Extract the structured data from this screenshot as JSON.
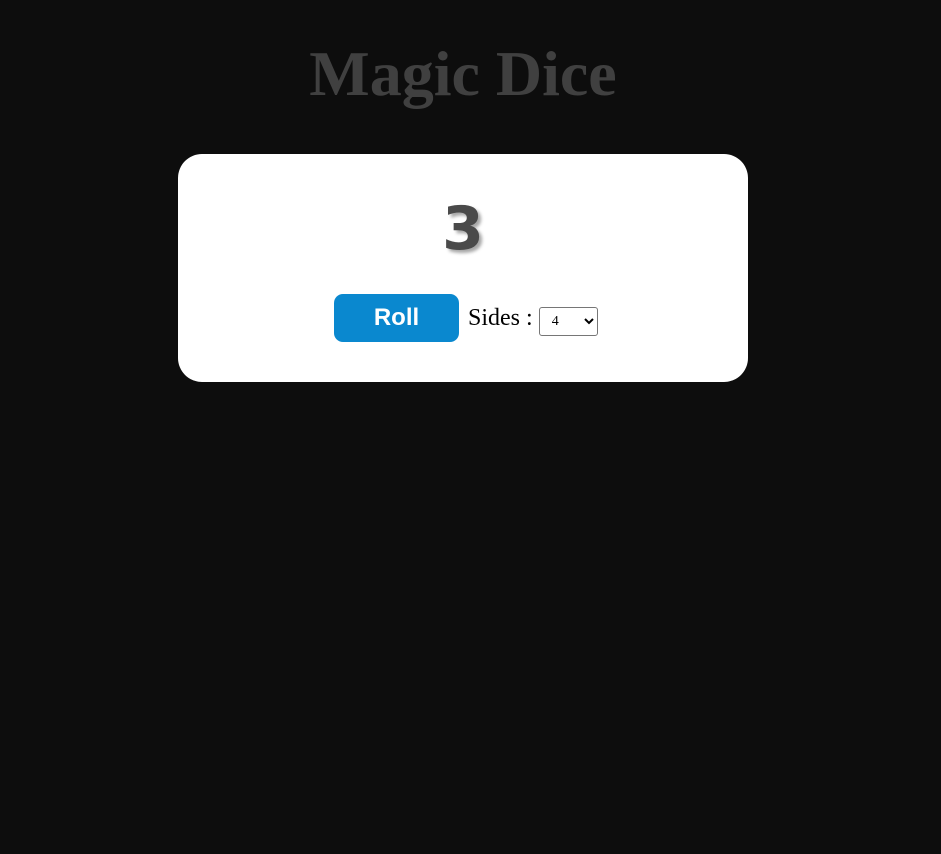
{
  "app": {
    "title": "Magic Dice"
  },
  "dice": {
    "result": "3"
  },
  "controls": {
    "roll_label": "Roll",
    "sides_label": "Sides :",
    "sides_selected": "4"
  },
  "colors": {
    "background": "#0d0d0d",
    "title": "#404040",
    "card": "#ffffff",
    "result": "#4a4a4a",
    "roll_button": "#0a88cf"
  }
}
